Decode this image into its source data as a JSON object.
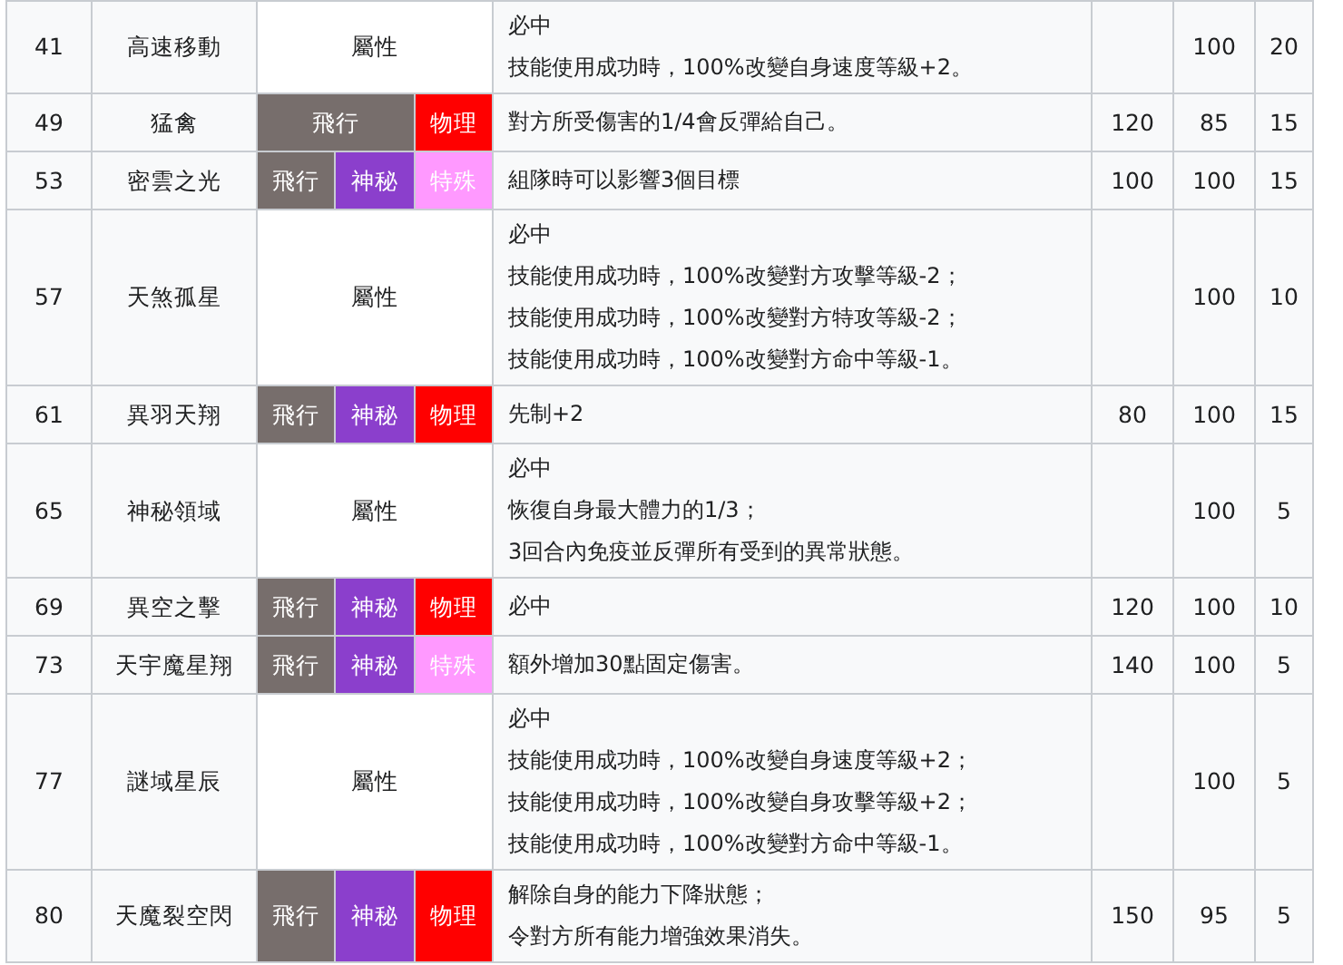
{
  "rows": [
    {
      "level": "41",
      "name": "高速移動",
      "types": [
        {
          "label": "屬性",
          "kind": "status"
        }
      ],
      "effect": [
        "必中",
        "技能使用成功時，100%改變自身速度等級+2。"
      ],
      "power": "",
      "accuracy": "100",
      "pp": "20"
    },
    {
      "level": "49",
      "name": "猛禽",
      "types": [
        {
          "label": "飛行",
          "kind": "flying",
          "wide": true
        },
        {
          "label": "物理",
          "kind": "physical",
          "wide": false
        }
      ],
      "effect": [
        "對方所受傷害的1/4會反彈給自己。"
      ],
      "power": "120",
      "accuracy": "85",
      "pp": "15"
    },
    {
      "level": "53",
      "name": "密雲之光",
      "types": [
        {
          "label": "飛行",
          "kind": "flying",
          "wide": false
        },
        {
          "label": "神秘",
          "kind": "mystic",
          "wide": false
        },
        {
          "label": "特殊",
          "kind": "special",
          "wide": false
        }
      ],
      "effect": [
        "組隊時可以影響3個目標"
      ],
      "power": "100",
      "accuracy": "100",
      "pp": "15"
    },
    {
      "level": "57",
      "name": "天煞孤星",
      "types": [
        {
          "label": "屬性",
          "kind": "status"
        }
      ],
      "effect": [
        "必中",
        "技能使用成功時，100%改變對方攻擊等級-2；",
        "技能使用成功時，100%改變對方特攻等級-2；",
        "技能使用成功時，100%改變對方命中等級-1。"
      ],
      "power": "",
      "accuracy": "100",
      "pp": "10"
    },
    {
      "level": "61",
      "name": "異羽天翔",
      "types": [
        {
          "label": "飛行",
          "kind": "flying",
          "wide": false
        },
        {
          "label": "神秘",
          "kind": "mystic",
          "wide": false
        },
        {
          "label": "物理",
          "kind": "physical",
          "wide": false
        }
      ],
      "effect": [
        "先制+2"
      ],
      "power": "80",
      "accuracy": "100",
      "pp": "15"
    },
    {
      "level": "65",
      "name": "神秘領域",
      "types": [
        {
          "label": "屬性",
          "kind": "status"
        }
      ],
      "effect": [
        "必中",
        "恢復自身最大體力的1/3；",
        "3回合內免疫並反彈所有受到的異常狀態。"
      ],
      "power": "",
      "accuracy": "100",
      "pp": "5"
    },
    {
      "level": "69",
      "name": "異空之擊",
      "types": [
        {
          "label": "飛行",
          "kind": "flying",
          "wide": false
        },
        {
          "label": "神秘",
          "kind": "mystic",
          "wide": false
        },
        {
          "label": "物理",
          "kind": "physical",
          "wide": false
        }
      ],
      "effect": [
        "必中"
      ],
      "power": "120",
      "accuracy": "100",
      "pp": "10"
    },
    {
      "level": "73",
      "name": "天宇魔星翔",
      "types": [
        {
          "label": "飛行",
          "kind": "flying",
          "wide": false
        },
        {
          "label": "神秘",
          "kind": "mystic",
          "wide": false
        },
        {
          "label": "特殊",
          "kind": "special",
          "wide": false
        }
      ],
      "effect": [
        "額外增加30點固定傷害。"
      ],
      "power": "140",
      "accuracy": "100",
      "pp": "5"
    },
    {
      "level": "77",
      "name": "謎域星辰",
      "types": [
        {
          "label": "屬性",
          "kind": "status"
        }
      ],
      "effect": [
        "必中",
        "技能使用成功時，100%改變自身速度等級+2；",
        "技能使用成功時，100%改變自身攻擊等級+2；",
        "技能使用成功時，100%改變對方命中等級-1。"
      ],
      "power": "",
      "accuracy": "100",
      "pp": "5"
    },
    {
      "level": "80",
      "name": "天魔裂空閃",
      "types": [
        {
          "label": "飛行",
          "kind": "flying",
          "wide": false
        },
        {
          "label": "神秘",
          "kind": "mystic",
          "wide": false
        },
        {
          "label": "物理",
          "kind": "physical",
          "wide": false
        }
      ],
      "effect": [
        "解除自身的能力下降狀態；",
        "令對方所有能力增強效果消失。"
      ],
      "power": "150",
      "accuracy": "95",
      "pp": "5"
    }
  ]
}
